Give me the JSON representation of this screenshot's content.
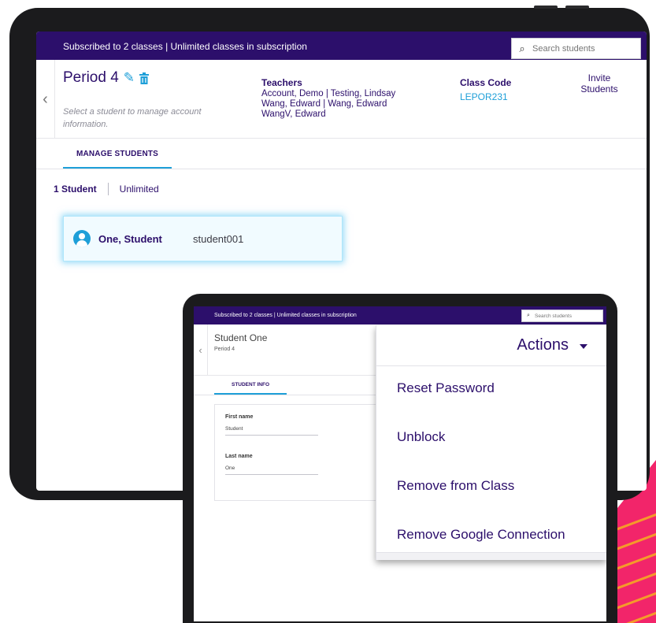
{
  "back_screen": {
    "subscription_text": "Subscribed to 2 classes | Unlimited classes in subscription",
    "search_placeholder": "Search students",
    "class_title": "Period 4",
    "hint": "Select a student to manage account information.",
    "teachers_label": "Teachers",
    "teachers": [
      "Account, Demo | Testing, Lindsay",
      "Wang, Edward | Wang, Edward",
      "WangV, Edward"
    ],
    "class_code_label": "Class Code",
    "class_code": "LEPOR231",
    "invite_line1": "Invite",
    "invite_line2": "Students",
    "tab_manage": "MANAGE STUDENTS",
    "student_count": "1 Student",
    "subscription_type": "Unlimited",
    "student": {
      "name": "One, Student",
      "username": "student001"
    }
  },
  "front_screen": {
    "subscription_text": "Subscribed to 2 classes | Unlimited classes in subscription",
    "search_placeholder": "Search students",
    "student_name": "Student One",
    "period": "Period 4",
    "tab_info": "STUDENT INFO",
    "first_name_label": "First name",
    "first_name": "Student",
    "last_name_label": "Last name",
    "last_name": "One",
    "actions": {
      "title": "Actions",
      "items": [
        "Reset Password",
        "Unblock",
        "Remove from Class",
        "Remove Google Connection"
      ]
    }
  },
  "colors": {
    "brand_purple": "#2c0f6b",
    "accent_blue": "#1e9fd8",
    "stripe_pink": "#f2256a",
    "stripe_orange": "#f59a2a"
  }
}
